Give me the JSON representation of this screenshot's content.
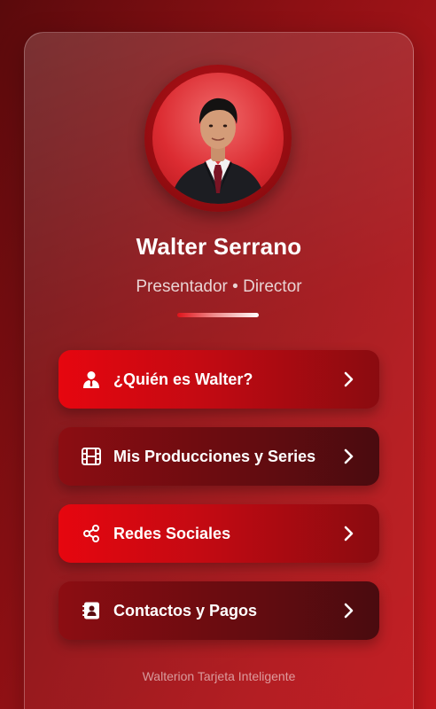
{
  "profile": {
    "name": "Walter Serrano",
    "role": "Presentador • Director"
  },
  "menu": [
    {
      "label": "¿Quién es Walter?",
      "icon": "user-tie-icon"
    },
    {
      "label": "Mis Producciones y Series",
      "icon": "film-icon"
    },
    {
      "label": "Redes Sociales",
      "icon": "share-icon"
    },
    {
      "label": "Contactos y Pagos",
      "icon": "contact-card-icon"
    }
  ],
  "footer": "Walterion Tarjeta Inteligente",
  "colors": {
    "accent": "#e6060f",
    "dark_button": "#6b0c10",
    "background": "#8e1014"
  }
}
